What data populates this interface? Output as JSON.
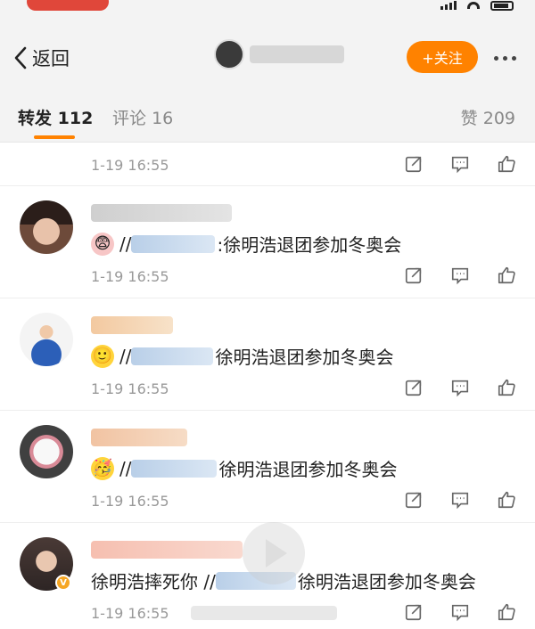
{
  "nav": {
    "back_label": "返回",
    "follow_label": "+关注"
  },
  "tabs": {
    "repost_label": "转发",
    "repost_count": "112",
    "comment_label": "评论",
    "comment_count": "16",
    "likes_label": "赞",
    "likes_count": "209"
  },
  "feed": {
    "items": [
      {
        "timestamp": "1-19 16:55"
      },
      {
        "timestamp": "1-19 16:55",
        "prefix": "//",
        "text": ":徐明浩退团参加冬奥会",
        "emoji": "face-emoji"
      },
      {
        "timestamp": "1-19 16:55",
        "prefix": "//",
        "text": "徐明浩退团参加冬奥会",
        "emoji": "smile-emoji"
      },
      {
        "timestamp": "1-19 16:55",
        "prefix": "//",
        "text": "徐明浩退团参加冬奥会",
        "emoji": "cake-emoji"
      },
      {
        "timestamp": "1-19 16:55",
        "lead": "徐明浩摔死你 //",
        "text": "徐明浩退团参加冬奥会"
      }
    ]
  },
  "colors": {
    "accent": "#ff8200",
    "timestamp": "#999999",
    "tab_background": "#f3f3f3"
  }
}
